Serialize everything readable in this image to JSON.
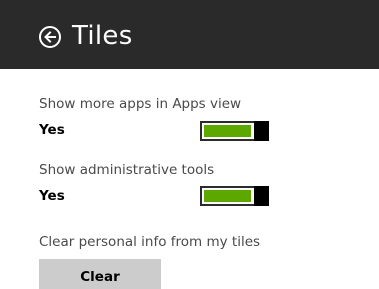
{
  "header": {
    "title": "Tiles",
    "back_icon": "back-arrow-circle-icon",
    "background": "#2a2a2a"
  },
  "settings": [
    {
      "label": "Show more apps in Apps view",
      "value": "Yes",
      "enabled": true
    },
    {
      "label": "Show administrative tools",
      "value": "Yes",
      "enabled": true
    }
  ],
  "clear_section": {
    "label": "Clear personal info from my tiles",
    "button_label": "Clear"
  },
  "colors": {
    "toggle_on": "#5ca800",
    "button_bg": "#cccccc"
  }
}
